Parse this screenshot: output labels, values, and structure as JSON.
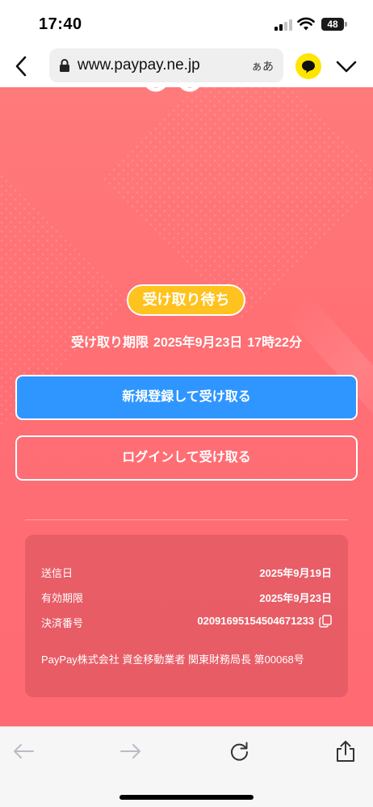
{
  "status_bar": {
    "time": "17:40",
    "battery": "48"
  },
  "browser": {
    "url": "www.paypay.ne.jp",
    "reader_label": "ぁあ"
  },
  "page": {
    "status_label": "受け取り待ち",
    "deadline_label": "受け取り期限",
    "deadline_date": "2025年9月23日",
    "deadline_time": "17時22分",
    "register_button": "新規登録して受け取る",
    "login_button": "ログインして受け取る"
  },
  "details": {
    "sent_date_label": "送信日",
    "sent_date_value": "2025年9月19日",
    "expiry_label": "有効期限",
    "expiry_value": "2025年9月23日",
    "payment_no_label": "決済番号",
    "payment_no_value": "02091695154504671233",
    "company": "PayPay株式会社 資金移動業者 関東財務局長 第00068号"
  },
  "colors": {
    "background": "#ff6f74",
    "status_pill": "#ffc21e",
    "register_button": "#2f96ff",
    "extension_badge": "#ffe500"
  },
  "icons": [
    "back-chevron-icon",
    "lock-icon",
    "chat-extension-icon",
    "chevron-down-icon",
    "copy-icon",
    "arrow-left-icon",
    "arrow-right-icon",
    "reload-icon",
    "share-icon"
  ]
}
